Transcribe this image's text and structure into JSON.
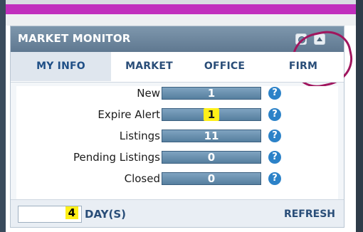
{
  "widget": {
    "title": "MARKET MONITOR",
    "tabs": [
      "MY INFO",
      "MARKET",
      "OFFICE",
      "FIRM"
    ],
    "active_tab": "MY INFO",
    "rows": [
      {
        "label": "New",
        "value": "1",
        "highlighted": false
      },
      {
        "label": "Expire Alert",
        "value": "1",
        "highlighted": true
      },
      {
        "label": "Listings",
        "value": "11",
        "highlighted": false
      },
      {
        "label": "Pending Listings",
        "value": "0",
        "highlighted": false
      },
      {
        "label": "Closed",
        "value": "0",
        "highlighted": false
      }
    ],
    "help_glyph": "?",
    "footer": {
      "days_value": "4",
      "days_label": "DAY(S)",
      "refresh_label": "REFRESH"
    }
  },
  "colors": {
    "header": "#5f7890",
    "magenta_bar": "#c12fbd",
    "bar": "#567f9f",
    "help": "#2c82c8",
    "highlight": "#ffef18",
    "annotation": "#a0165e"
  }
}
